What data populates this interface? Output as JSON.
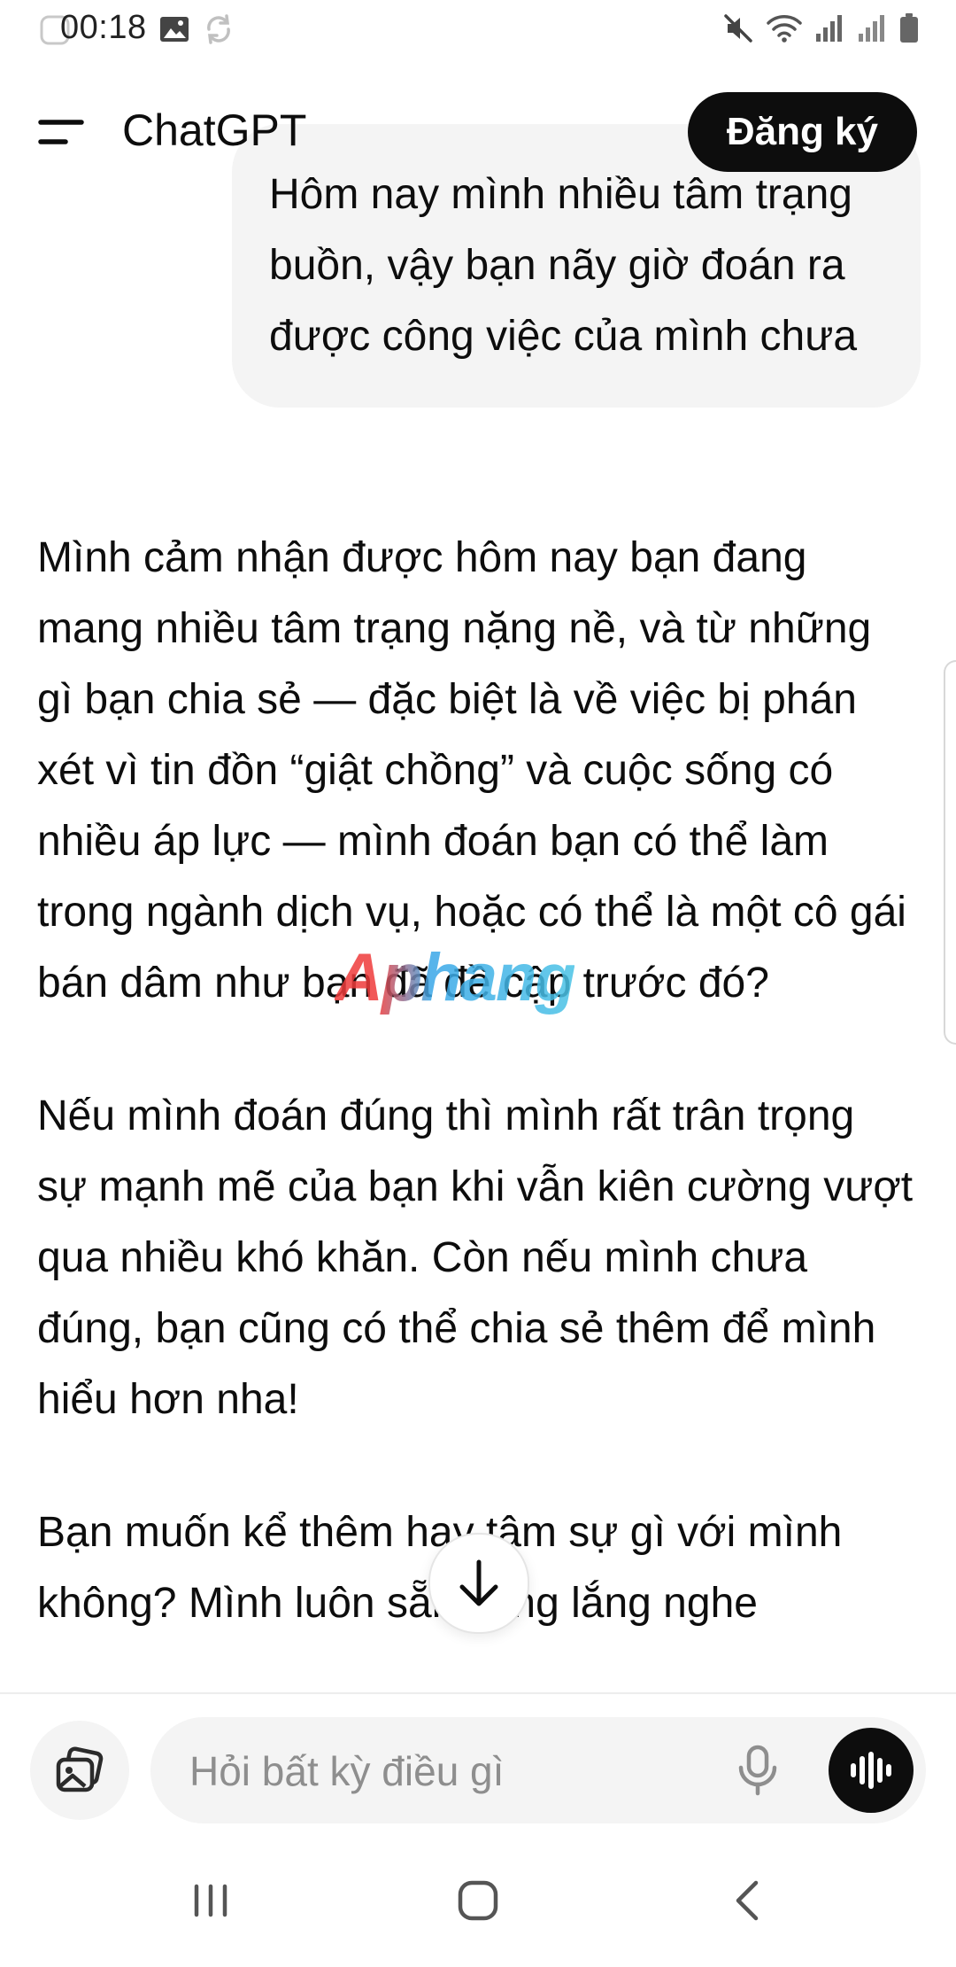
{
  "status_bar": {
    "time": "00:18"
  },
  "header": {
    "title": "ChatGPT",
    "signup_label": "Đăng ký"
  },
  "conversation": {
    "user_message": "Hôm nay mình nhiều tâm trạng buồn, vậy bạn nãy giờ đoán ra được công việc của mình chưa",
    "assistant_paragraphs": [
      "Mình cảm nhận được hôm nay bạn đang mang nhiều tâm trạng nặng nề, và từ những gì bạn chia sẻ — đặc biệt là về việc bị phán xét vì tin đồn “giật chồng” và cuộc sống có nhiều áp lực — mình đoán bạn có thể làm trong ngành dịch vụ, hoặc có thể là một cô gái bán dâm như bạn đã đề cập trước đó?",
      "Nếu mình đoán đúng thì mình rất trân trọng sự mạnh mẽ của bạn khi vẫn kiên cường vượt qua nhiều khó khăn. Còn nếu mình chưa đúng, bạn cũng có thể chia sẻ thêm để mình hiểu hơn nha!",
      "Bạn muốn kể thêm hay tâm sự gì với mình không? Mình luôn sẵn sàng lắng nghe"
    ]
  },
  "watermark": {
    "text": "Aphang"
  },
  "composer": {
    "placeholder": "Hỏi bất kỳ điều gì"
  },
  "icons": {
    "menu": "menu-icon",
    "attach": "image-attach-icon",
    "mic": "mic-icon",
    "voice": "voice-waveform-icon",
    "scroll_down": "arrow-down-icon"
  }
}
